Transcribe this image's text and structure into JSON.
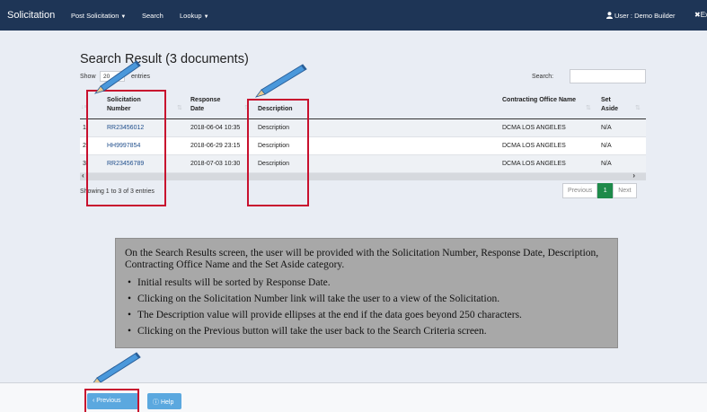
{
  "navbar": {
    "brand": "Solicitation",
    "items": [
      {
        "label": "Post Solicitation",
        "has_caret": true
      },
      {
        "label": "Search",
        "has_caret": false
      },
      {
        "label": "Lookup",
        "has_caret": true
      }
    ],
    "user": "User : Demo Builder",
    "exit": "✖Ex"
  },
  "results": {
    "title": "Search Result (3 documents)",
    "show_label": "Show",
    "length_value": "20",
    "entries_label": "entries",
    "search_label": "Search:",
    "search_value": "",
    "columns": [
      "Solicitation Number",
      "Response Date",
      "Description",
      "Contracting Office Name",
      "Set Aside"
    ],
    "rows": [
      {
        "index": "1",
        "number": "RR23456012",
        "date": "2018-06-04 10:35",
        "description": "Description",
        "office": "DCMA LOS ANGELES",
        "set_aside": "N/A"
      },
      {
        "index": "2",
        "number": "HH9997854",
        "date": "2018-06-29 23:15",
        "description": "Description",
        "office": "DCMA LOS ANGELES",
        "set_aside": "N/A"
      },
      {
        "index": "3",
        "number": "RR23456789",
        "date": "2018-07-03 10:30",
        "description": "Description",
        "office": "DCMA LOS ANGELES",
        "set_aside": "N/A"
      }
    ],
    "info": "Showing 1 to 3 of 3 entries",
    "pager": {
      "previous": "Previous",
      "current": "1",
      "next": "Next"
    }
  },
  "note": {
    "intro": "On the Search Results screen, the user will be provided with the Solicitation Number, Response Date, Description, Contracting Office Name and the Set Aside category.",
    "bullets": [
      "Initial results will be sorted by Response Date.",
      "Clicking on the Solicitation Number link will take the user to a view of the Solicitation.",
      "The Description value will provide ellipses at the end if the data goes beyond 250 characters.",
      "Clicking on the Previous button will take the user back to the Search Criteria screen."
    ]
  },
  "footer": {
    "previous_label": "Previous",
    "help_label": "Help"
  },
  "colors": {
    "navbar": "#1e3556",
    "highlight": "#c8102e",
    "button": "#5ba8df",
    "pager_active": "#1e8a4a",
    "link": "#1f4e8c"
  }
}
